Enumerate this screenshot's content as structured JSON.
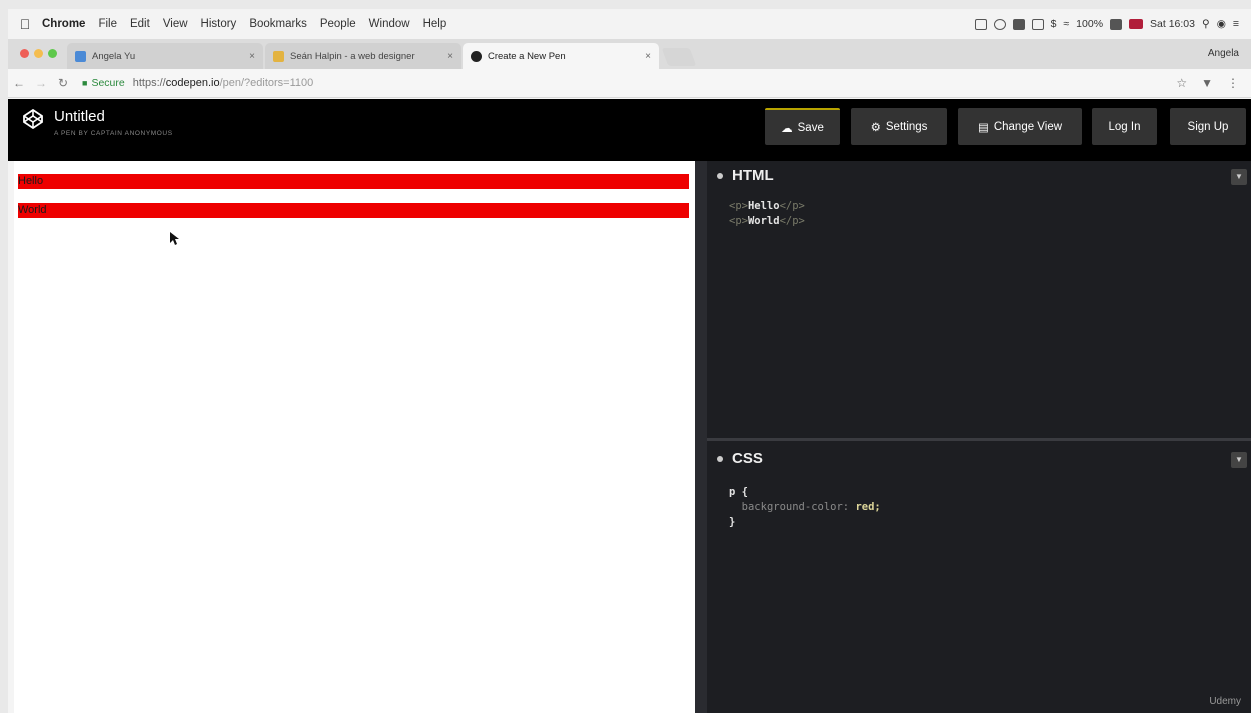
{
  "menubar": {
    "app": "Chrome",
    "items": [
      "File",
      "Edit",
      "View",
      "History",
      "Bookmarks",
      "People",
      "Window",
      "Help"
    ],
    "battery": "100%",
    "clock": "Sat 16:03"
  },
  "tabs": [
    {
      "title": "Angela Yu",
      "close": "×",
      "active": false,
      "color": "#4b8ad6"
    },
    {
      "title": "Seán Halpin - a web designer",
      "close": "×",
      "active": false,
      "color": "#e3b341"
    },
    {
      "title": "Create a New Pen",
      "close": "×",
      "active": true,
      "color": "#222222"
    }
  ],
  "profile": "Angela",
  "address": {
    "secure_label": "Secure",
    "url_scheme": "https://",
    "url_host": "codepen.io",
    "url_path": "/pen/?editors=1100"
  },
  "codepen": {
    "title": "Untitled",
    "subtitle": "A PEN BY CAPTAIN ANONYMOUS",
    "buttons": {
      "save": "Save",
      "settings": "Settings",
      "change_view": "Change View",
      "login": "Log In",
      "signup": "Sign Up"
    }
  },
  "preview": {
    "lines": [
      "Hello",
      "World"
    ],
    "background": "#ee0000"
  },
  "html_panel": {
    "title": "HTML",
    "code": [
      {
        "open": "<p>",
        "text": "Hello",
        "close": "</p>"
      },
      {
        "open": "<p>",
        "text": "World",
        "close": "</p>"
      }
    ]
  },
  "css_panel": {
    "title": "CSS",
    "selector": "p {",
    "property": "background-color:",
    "value": "red;",
    "closing": "}"
  },
  "watermark": "Udemy"
}
